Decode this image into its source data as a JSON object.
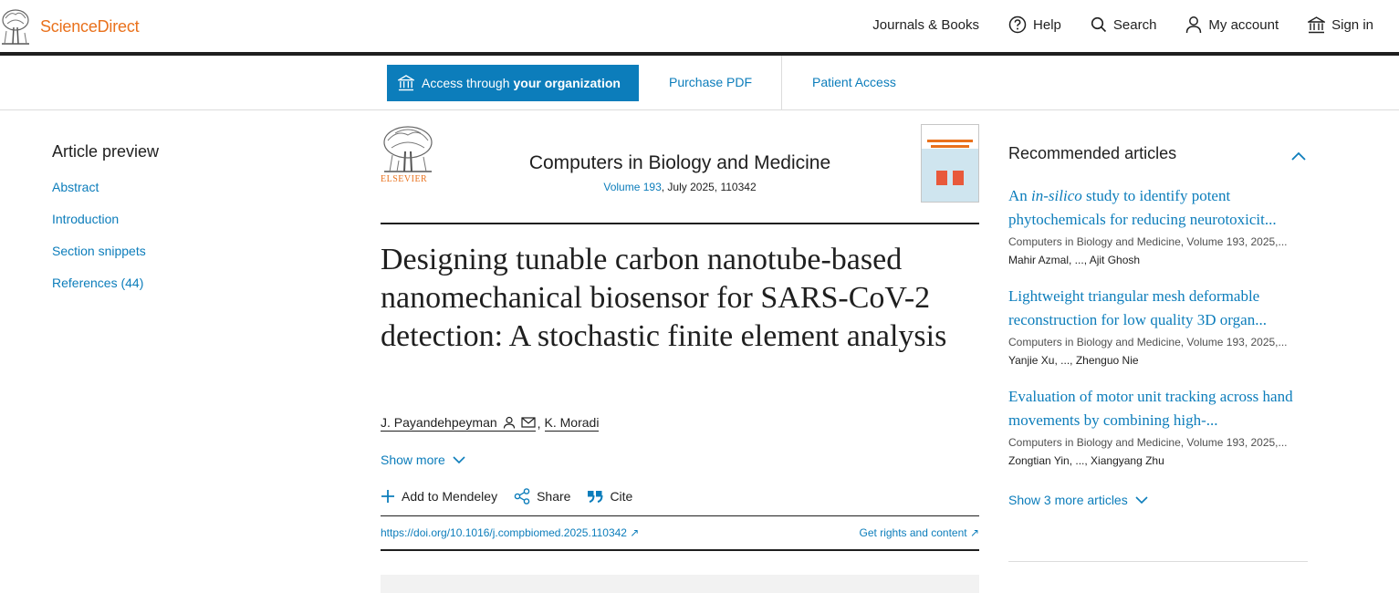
{
  "header": {
    "brand": "ScienceDirect",
    "nav": [
      {
        "label": "Journals & Books",
        "icon": "none"
      },
      {
        "label": "Help",
        "icon": "help-icon"
      },
      {
        "label": "Search",
        "icon": "search-icon"
      },
      {
        "label": "My account",
        "icon": "person-icon"
      },
      {
        "label": "Sign in",
        "icon": "institution-icon"
      }
    ]
  },
  "access": {
    "access_prefix": "Access through",
    "access_bold": "your organization",
    "purchase": "Purchase PDF",
    "patient": "Patient Access"
  },
  "preview": {
    "heading": "Article preview",
    "links": [
      "Abstract",
      "Introduction",
      "Section snippets",
      "References (44)"
    ]
  },
  "journal": {
    "publisher_word": "ELSEVIER",
    "title": "Computers in Biology and Medicine",
    "volume": "Volume 193",
    "date_id": ", July 2025, 110342"
  },
  "article": {
    "title": "Designing tunable carbon nanotube-based nanomechanical biosensor for SARS-CoV-2 detection: A stochastic finite element analysis",
    "authors": [
      "J. Payandehpeyman",
      "K. Moradi"
    ],
    "show_more": "Show more",
    "actions": [
      "Add to Mendeley",
      "Share",
      "Cite"
    ],
    "doi": "https://doi.org/10.1016/j.compbiomed.2025.110342 ↗",
    "rights": "Get rights and content ↗"
  },
  "recommended": {
    "heading": "Recommended articles",
    "items": [
      {
        "title_pre": "An ",
        "title_italic": "in-silico",
        "title_post": " study to identify potent phytochemicals for reducing neurotoxicit...",
        "source": "Computers in Biology and Medicine, Volume 193, 2025,...",
        "authors": "Mahir Azmal, ..., Ajit Ghosh"
      },
      {
        "title_pre": "Lightweight triangular mesh deformable reconstruction for low quality 3D organ...",
        "title_italic": "",
        "title_post": "",
        "source": "Computers in Biology and Medicine, Volume 193, 2025,...",
        "authors": "Yanjie Xu, ..., Zhenguo Nie"
      },
      {
        "title_pre": "Evaluation of motor unit tracking across hand movements by combining high-...",
        "title_italic": "",
        "title_post": "",
        "source": "Computers in Biology and Medicine, Volume 193, 2025,...",
        "authors": "Zongtian Yin, ..., Xiangyang Zhu"
      }
    ],
    "show_more": "Show 3 more articles"
  },
  "colors": {
    "brand_orange": "#e9711c",
    "link_blue": "#0c7dbb",
    "text": "#1f1f1f"
  }
}
